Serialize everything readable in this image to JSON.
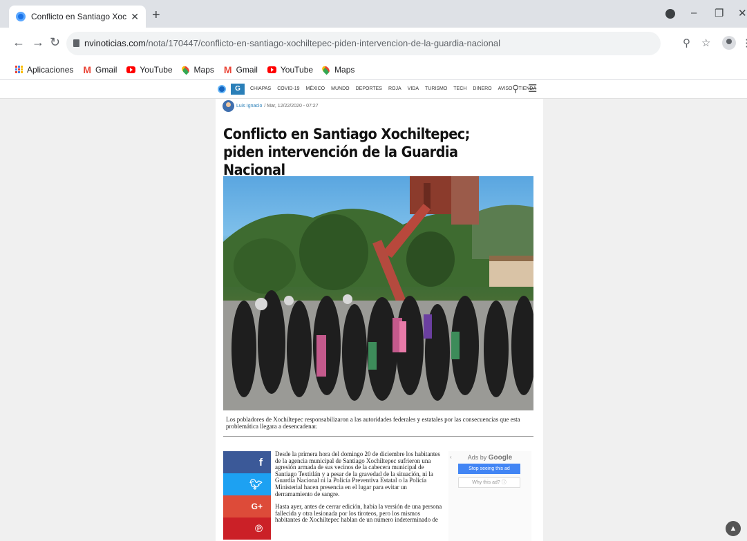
{
  "browser": {
    "tab_title": "Conflicto en Santiago Xochiltepec",
    "url_domain": "nvinoticias.com",
    "url_path": "/nota/170447/conflicto-en-santiago-xochiltepec-piden-intervencion-de-la-guardia-nacional",
    "bookmarks": [
      {
        "label": "Aplicaciones",
        "icon": "apps-icon"
      },
      {
        "label": "Gmail",
        "icon": "gmail-icon"
      },
      {
        "label": "YouTube",
        "icon": "youtube-icon"
      },
      {
        "label": "Maps",
        "icon": "maps-icon"
      },
      {
        "label": "Gmail",
        "icon": "gmail-icon"
      },
      {
        "label": "YouTube",
        "icon": "youtube-icon"
      },
      {
        "label": "Maps",
        "icon": "maps-icon"
      }
    ]
  },
  "site": {
    "nav": [
      "CHIAPAS",
      "COVID-19",
      "MÉXICO",
      "MUNDO",
      "DEPORTES",
      "ROJA",
      "VIDA",
      "TURISMO",
      "TECH",
      "DINERO",
      "AVISO",
      "TIENDA"
    ]
  },
  "article": {
    "author": "Luis Ignacio",
    "date": "Mar, 12/22/2020 - 07:27",
    "headline": "Conflicto en Santiago Xochiltepec; piden intervención de la Guardia Nacional",
    "caption": "Los pobladores de Xochiltepec responsabilizaron a las autoridades federales y estatales por las consecuencias que esta problemática llegara a desencadenar.",
    "paragraphs": [
      "Desde la primera hora del domingo 20 de diciembre los habitantes de la agencia municipal de Santiago Xochiltepec sufrieron una agresión armada de sus vecinos de la cabecera municipal de Santiago Textitlán y a pesar de la gravedad de la situación, ni la Guardia Nacional ni la Policía Preventiva Estatal o la Policía Ministerial hacen presencia en el lugar para evitar un derramamiento de sangre.",
      "Hasta ayer, antes de cerrar edición, había la versión de una persona fallecida y otra lesionada por los tiroteos, pero los mismos habitantes de Xochiltepec hablan de un número indeterminado de"
    ]
  },
  "ad": {
    "label_prefix": "Ads by",
    "label_brand": "Google",
    "stop_label": "Stop seeing this ad",
    "why_label": "Why this ad? ⓘ"
  },
  "colors": {
    "facebook": "#3b5998",
    "twitter": "#1da1f2",
    "googleplus": "#dd4b39",
    "pinterest": "#cb2027"
  }
}
